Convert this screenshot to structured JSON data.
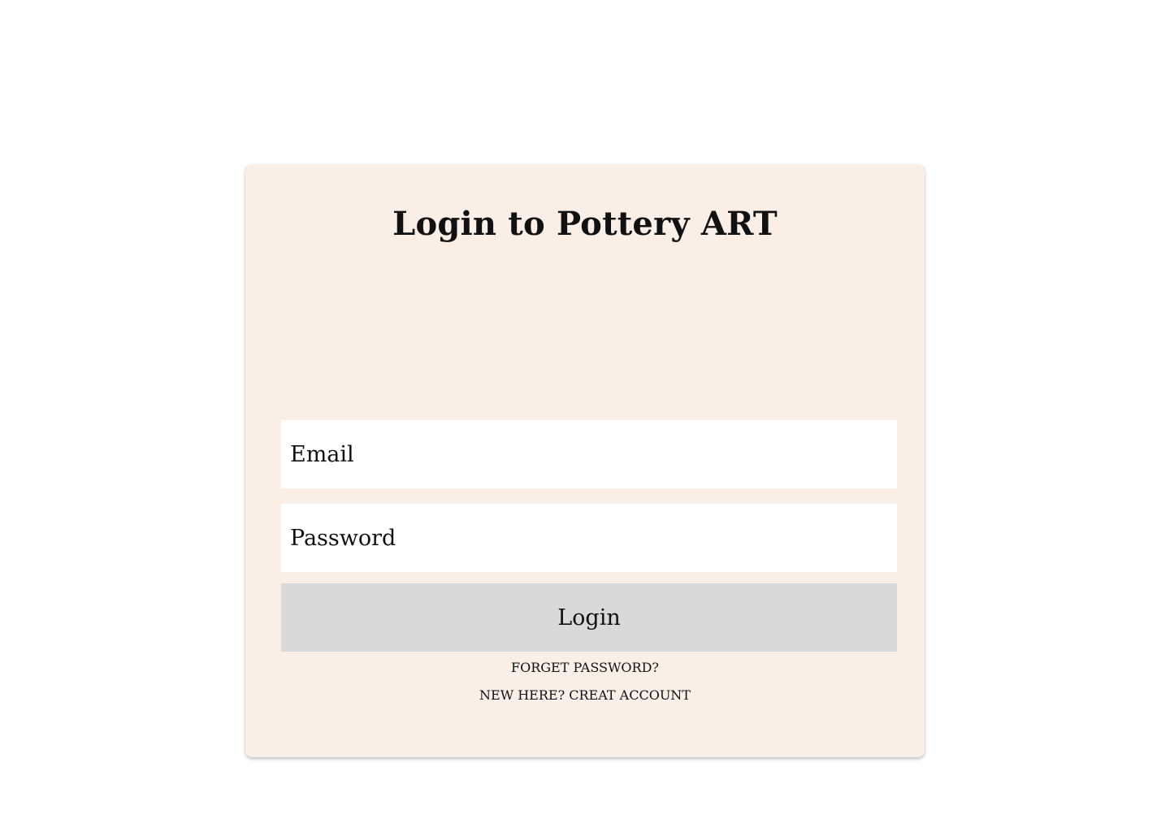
{
  "login_card": {
    "title": "Login to Pottery ART",
    "email_placeholder": "Email",
    "password_placeholder": "Password",
    "login_label": "Login",
    "forgot_password_label": "FORGET PASSWORD?",
    "create_account_label": "NEW HERE? CREAT ACCOUNT"
  },
  "colors": {
    "card_background": "#f9efe7",
    "input_background": "#ffffff",
    "button_background": "#d9d9d9",
    "text": "#111111"
  }
}
